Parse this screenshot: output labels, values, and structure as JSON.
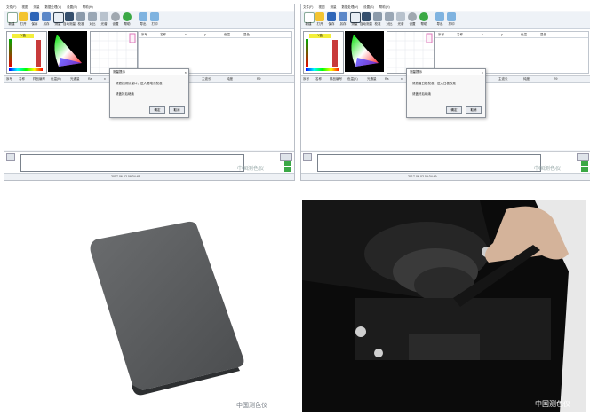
{
  "screens": [
    {
      "menu": [
        "文件(F)",
        "视图",
        "测量",
        "数据处理(V)",
        "设置(S)",
        "帮助(H)"
      ],
      "toolbar": [
        "新建",
        "打开",
        "保存",
        "另存",
        "测量",
        "自动测量",
        "校准",
        "对比",
        "光谱",
        "设置",
        "帮助",
        "导出",
        "打印"
      ],
      "bar_label": "Y值",
      "info_headers": [
        "序号",
        "名称",
        "x",
        "y",
        "色温",
        "显色"
      ],
      "grid_headers": [
        "序号",
        "名称",
        "样品编号",
        "色温(K)",
        "光通量",
        "Ra",
        "x",
        "y",
        "波长",
        "峰值",
        "dom",
        "主波长",
        "纯度",
        "R9"
      ],
      "dialog": {
        "title": "测量提示",
        "line1": "请遮挡测试窗口，进入暗电流校准",
        "line2": "请盖好后继续",
        "ok": "确定",
        "cancel": "取消"
      },
      "status": "2017-06-02 09:34:45"
    },
    {
      "menu": [
        "文件(F)",
        "视图",
        "测量",
        "数据处理(V)",
        "设置(S)",
        "帮助(H)"
      ],
      "toolbar": [
        "新建",
        "打开",
        "保存",
        "另存",
        "测量",
        "自动测量",
        "校准",
        "对比",
        "光谱",
        "设置",
        "帮助",
        "导出",
        "打印"
      ],
      "bar_label": "Y值",
      "info_headers": [
        "序号",
        "名称",
        "x",
        "y",
        "色温",
        "显色"
      ],
      "grid_headers": [
        "序号",
        "名称",
        "样品编号",
        "色温(K)",
        "光通量",
        "Ra",
        "x",
        "y",
        "波长",
        "峰值",
        "dom",
        "主波长",
        "纯度",
        "R9"
      ],
      "dialog": {
        "title": "测量提示",
        "line1": "请放置白板校准，进入白板校准",
        "line2": "请盖好后继续",
        "ok": "确定",
        "cancel": "取消"
      },
      "status": "2017-06-02 09:34:49"
    }
  ],
  "watermark_small": "中国测色仪",
  "watermark_card": "中国测色仪",
  "watermark_device": "中国测色仪",
  "colors": {
    "toolbar_bg": "#eef2f7",
    "window_bg": "#f4f6f9",
    "dialog_bg": "#f7f7f7",
    "accent_green": "#3aa845"
  }
}
